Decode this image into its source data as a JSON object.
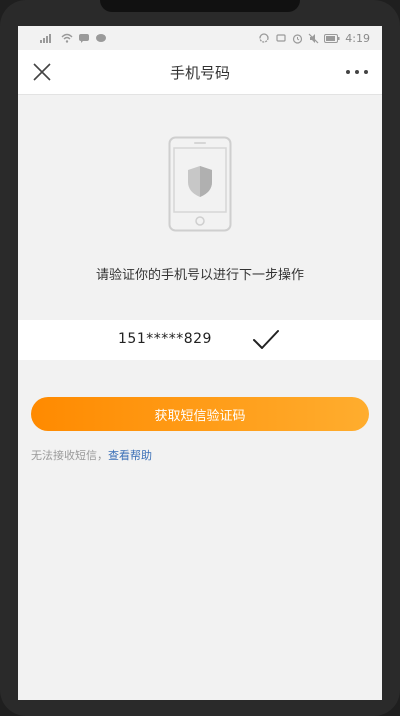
{
  "status_bar": {
    "time": "4:19"
  },
  "nav": {
    "title": "手机号码"
  },
  "main": {
    "prompt": "请验证你的手机号以进行下一步操作",
    "phone_number": "151*****829",
    "primary_button_label": "获取短信验证码",
    "help_text": "无法接收短信，",
    "help_link_label": "查看帮助"
  },
  "colors": {
    "accent_start": "#ff8a00",
    "accent_end": "#ffad2e",
    "link": "#3a6fb7"
  },
  "icons": [
    "signal-icon",
    "wifi-icon",
    "message-icon",
    "sync-icon",
    "alarm-icon",
    "mute-icon",
    "battery-icon",
    "close-icon",
    "more-icon",
    "phone-shield-icon",
    "check-icon"
  ]
}
